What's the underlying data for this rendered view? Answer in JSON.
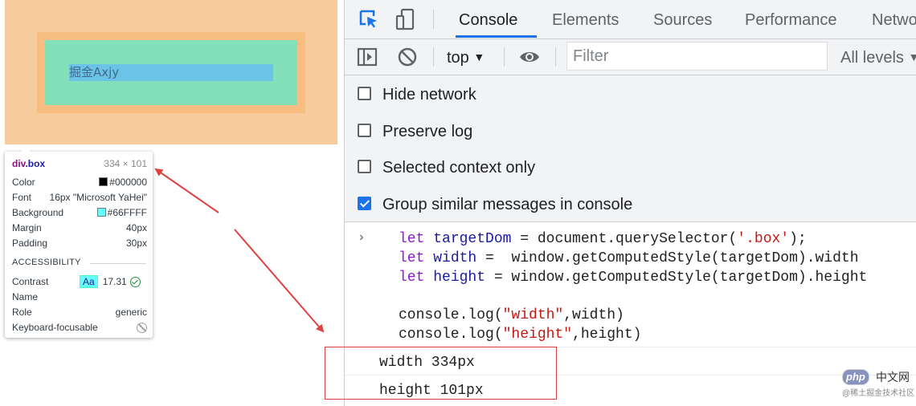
{
  "page_preview": {
    "content_text": "掘金Axjy"
  },
  "tooltip": {
    "tag": "div",
    "class": ".box",
    "size": "334 × 101",
    "rows": [
      {
        "key": "Color",
        "value": "#000000",
        "swatch": "#000000"
      },
      {
        "key": "Font",
        "value": "16px \"Microsoft YaHei\""
      },
      {
        "key": "Background",
        "value": "#66FFFF",
        "swatch": "#66FFFF"
      },
      {
        "key": "Margin",
        "value": "40px"
      },
      {
        "key": "Padding",
        "value": "30px"
      }
    ],
    "accessibility_header": "ACCESSIBILITY",
    "accessibility": {
      "contrast_label": "Contrast",
      "contrast_badge": "Aa",
      "contrast_value": "17.31",
      "name_label": "Name",
      "role_label": "Role",
      "role_value": "generic",
      "focusable_label": "Keyboard-focusable"
    }
  },
  "devtools": {
    "tabs": [
      {
        "label": "Console",
        "active": true
      },
      {
        "label": "Elements"
      },
      {
        "label": "Sources"
      },
      {
        "label": "Performance"
      },
      {
        "label": "Netwo"
      }
    ],
    "toolbar": {
      "context": "top",
      "filter_placeholder": "Filter",
      "levels": "All levels"
    },
    "settings": [
      {
        "label": "Hide network",
        "checked": false
      },
      {
        "label": "Preserve log",
        "checked": false
      },
      {
        "label": "Selected context only",
        "checked": false
      },
      {
        "label": "Group similar messages in console",
        "checked": true
      }
    ],
    "console": {
      "prompt": "›",
      "code": [
        {
          "kw": "let ",
          "var": "targetDom",
          "rest": " = document.querySelector(",
          "str": "'.box'",
          "end": ");"
        },
        {
          "kw": "let ",
          "var": "width",
          "rest": " =  window.getComputedStyle(targetDom).width",
          "str": "",
          "end": ""
        },
        {
          "kw": "let ",
          "var": "height",
          "rest": " = window.getComputedStyle(targetDom).height",
          "str": "",
          "end": ""
        },
        {
          "kw": "",
          "var": "",
          "rest": "",
          "str": "",
          "end": ""
        },
        {
          "kw": "",
          "var": "",
          "rest": "console.log(",
          "str": "\"width\"",
          "end": ",width)"
        },
        {
          "kw": "",
          "var": "",
          "rest": "console.log(",
          "str": "\"height\"",
          "end": ",height)"
        }
      ],
      "output": [
        "width 334px",
        "height 101px"
      ]
    }
  },
  "watermark": {
    "php": "php",
    "cn": "中文网",
    "sub": "@稀土掘金技术社区"
  },
  "colors": {
    "margin": "#f8cb9c",
    "padding": "#84e0b9",
    "content": "#6cc3e8",
    "accent": "#1a73e8",
    "annotation": "#e04040"
  }
}
